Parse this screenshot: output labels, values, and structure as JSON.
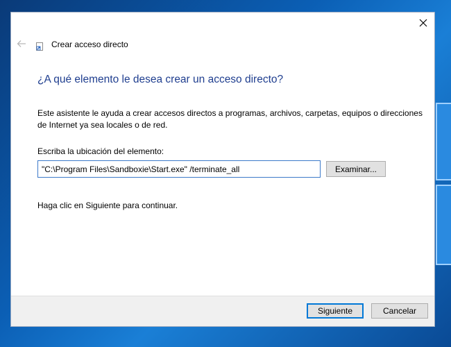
{
  "window": {
    "title": "Crear acceso directo",
    "close_symbol": "×"
  },
  "icons": {
    "back": "back-arrow-icon",
    "close": "close-icon",
    "shortcut": "shortcut-icon"
  },
  "content": {
    "heading": "¿A qué elemento le desea crear un acceso directo?",
    "description": "Este asistente le ayuda a crear accesos directos a programas, archivos, carpetas, equipos o direcciones de Internet ya sea locales o de red.",
    "location_label": "Escriba la ubicación del elemento:",
    "location_value": "\"C:\\Program Files\\Sandboxie\\Start.exe\" /terminate_all",
    "browse_label": "Examinar...",
    "continue_hint": "Haga clic en Siguiente para continuar."
  },
  "footer": {
    "next_label": "Siguiente",
    "cancel_label": "Cancelar"
  },
  "colors": {
    "heading": "#1f3e8f",
    "focus_border": "#0078d7",
    "desktop": "#0b5fb5"
  }
}
